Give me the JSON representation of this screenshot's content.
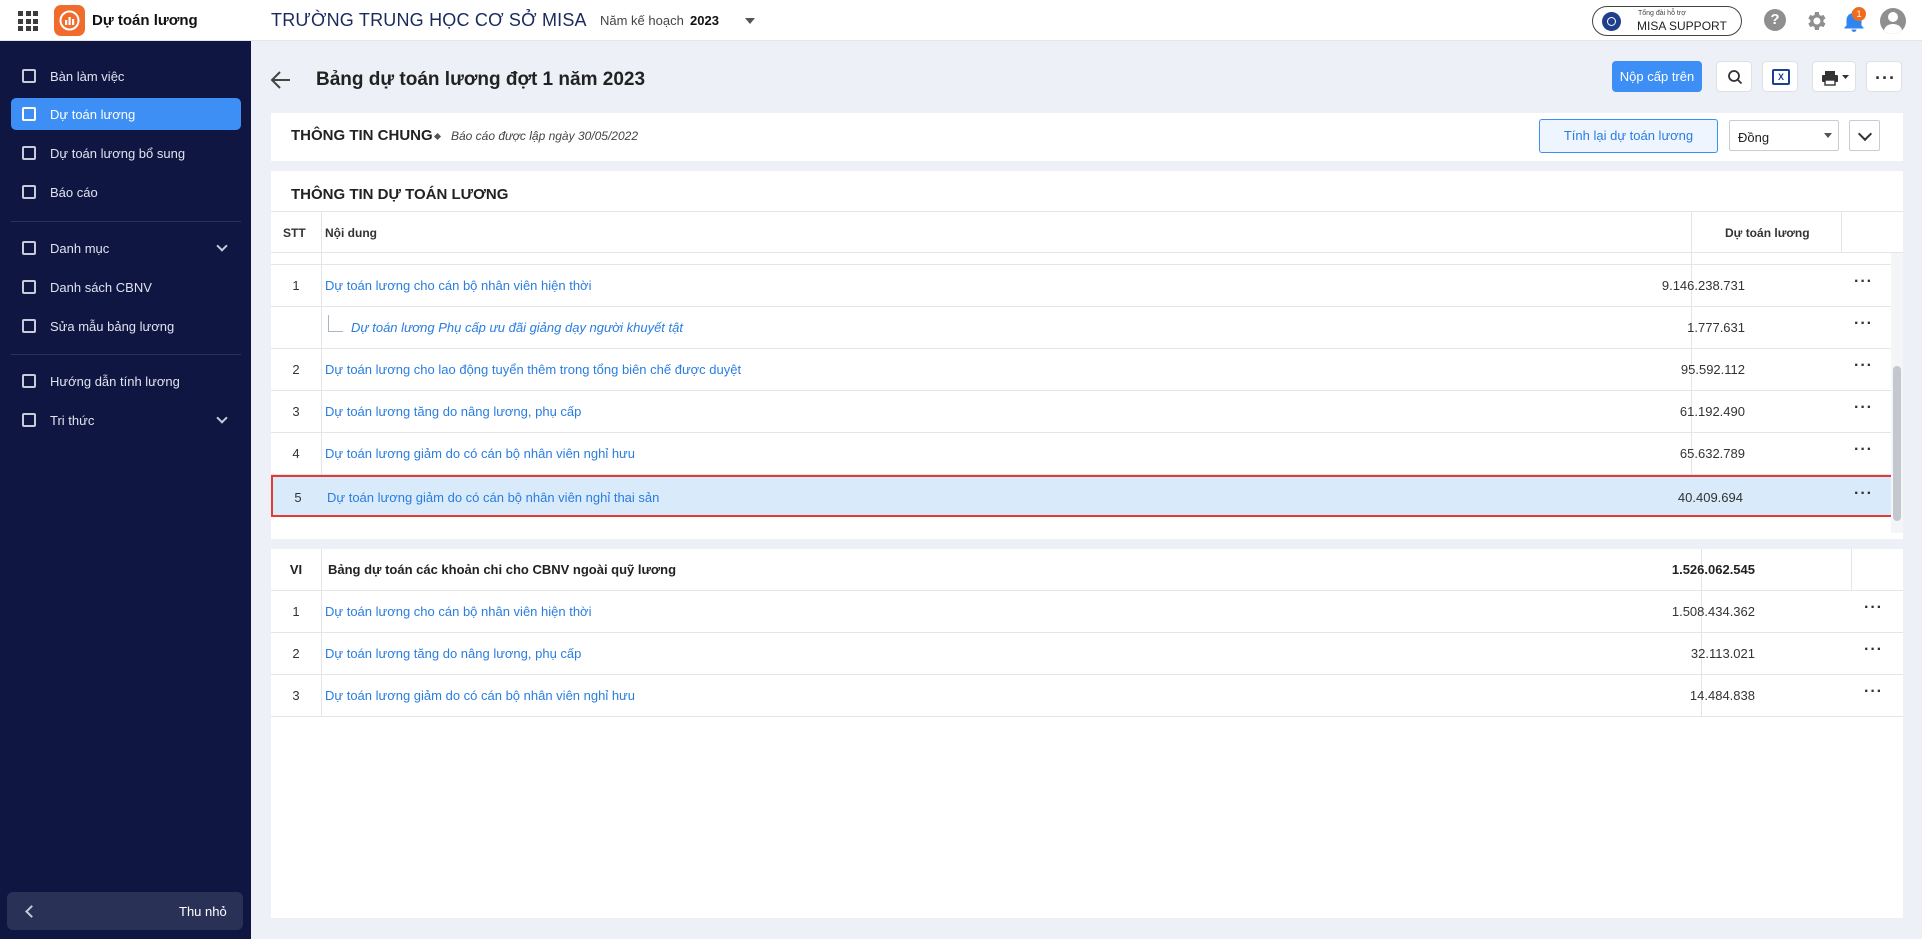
{
  "topbar": {
    "app_name": "Dự toán lương",
    "school_name": "TRƯỜNG TRUNG HỌC CƠ SỞ MISA",
    "plan_year_label": "Năm kế hoạch",
    "plan_year": "2023",
    "support_small": "Tổng đài hỗ trợ",
    "support_main": "MISA SUPPORT",
    "notification_count": "1",
    "help_glyph": "?"
  },
  "sidebar": {
    "items": [
      {
        "label": "Bàn làm việc",
        "icon": "desk-icon"
      },
      {
        "label": "Dự toán lương",
        "icon": "estimate-icon",
        "active": true
      },
      {
        "label": "Dự toán lương bổ sung",
        "icon": "supplement-icon"
      },
      {
        "label": "Báo cáo",
        "icon": "report-icon"
      },
      {
        "label": "Danh mục",
        "icon": "list-icon"
      },
      {
        "label": "Danh sách CBNV",
        "icon": "staff-icon"
      },
      {
        "label": "Sửa mẫu bảng lương",
        "icon": "template-icon"
      },
      {
        "label": "Hướng dẫn tính lương",
        "icon": "guide-icon"
      },
      {
        "label": "Tri thức",
        "icon": "knowledge-icon"
      }
    ],
    "collapse_label": "Thu nhỏ"
  },
  "page": {
    "title": "Bảng dự toán lương đợt 1 năm 2023",
    "submit_label": "Nộp cấp trên",
    "excel_label": "X"
  },
  "info": {
    "title": "THÔNG TIN CHUNG",
    "note": "Báo cáo được lập ngày 30/05/2022",
    "recalc_label": "Tính lại dự toán lương",
    "unit": "Đồng"
  },
  "main": {
    "title": "THÔNG TIN DỰ TOÁN LƯƠNG",
    "columns": {
      "stt": "STT",
      "content": "Nội dung",
      "amount": "Dự toán lương"
    },
    "rows": [
      {
        "stt": "1",
        "content": "Dự toán lương cho cán bộ nhân viên hiện thời",
        "amount": "9.146.238.731"
      },
      {
        "stt": "",
        "content": "Dự toán lương Phụ cấp ưu đãi giảng dạy người khuyết tật",
        "amount": "1.777.631",
        "sub": true
      },
      {
        "stt": "2",
        "content": "Dự toán lương cho lao động tuyển thêm trong tổng biên chế được duyệt",
        "amount": "95.592.112"
      },
      {
        "stt": "3",
        "content": "Dự toán lương tăng do nâng lương, phụ cấp",
        "amount": "61.192.490"
      },
      {
        "stt": "4",
        "content": "Dự toán lương giảm do có cán bộ nhân viên nghỉ hưu",
        "amount": "65.632.789"
      },
      {
        "stt": "5",
        "content": "Dự toán lương giảm do có cán bộ nhân viên nghỉ thai sản",
        "amount": "40.409.694",
        "selected": true
      }
    ]
  },
  "section_vi": {
    "header": {
      "stt": "VI",
      "content": "Bảng dự toán các khoản chi cho CBNV ngoài quỹ lương",
      "amount": "1.526.062.545"
    },
    "rows": [
      {
        "stt": "1",
        "content": "Dự toán lương cho cán bộ nhân viên hiện thời",
        "amount": "1.508.434.362"
      },
      {
        "stt": "2",
        "content": "Dự toán lương tăng do nâng lương, phụ cấp",
        "amount": "32.113.021"
      },
      {
        "stt": "3",
        "content": "Dự toán lương giảm do có cán bộ nhân viên nghỉ hưu",
        "amount": "14.484.838"
      }
    ]
  },
  "more_glyph": "···"
}
